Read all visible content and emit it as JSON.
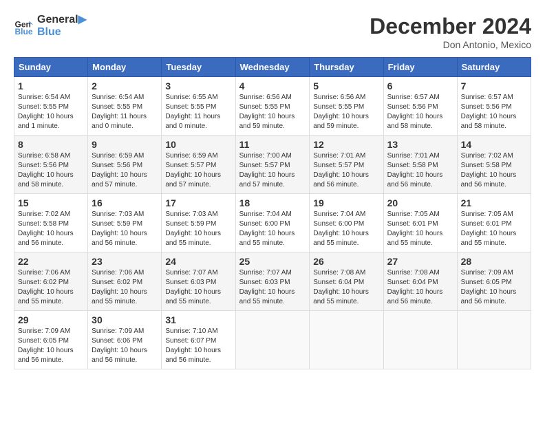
{
  "header": {
    "logo_line1": "General",
    "logo_line2": "Blue",
    "month": "December 2024",
    "location": "Don Antonio, Mexico"
  },
  "weekdays": [
    "Sunday",
    "Monday",
    "Tuesday",
    "Wednesday",
    "Thursday",
    "Friday",
    "Saturday"
  ],
  "weeks": [
    [
      {
        "day": "1",
        "sunrise": "6:54 AM",
        "sunset": "5:55 PM",
        "daylight": "10 hours and 1 minute."
      },
      {
        "day": "2",
        "sunrise": "6:54 AM",
        "sunset": "5:55 PM",
        "daylight": "11 hours and 0 minutes."
      },
      {
        "day": "3",
        "sunrise": "6:55 AM",
        "sunset": "5:55 PM",
        "daylight": "11 hours and 0 minutes."
      },
      {
        "day": "4",
        "sunrise": "6:56 AM",
        "sunset": "5:55 PM",
        "daylight": "10 hours and 59 minutes."
      },
      {
        "day": "5",
        "sunrise": "6:56 AM",
        "sunset": "5:55 PM",
        "daylight": "10 hours and 59 minutes."
      },
      {
        "day": "6",
        "sunrise": "6:57 AM",
        "sunset": "5:56 PM",
        "daylight": "10 hours and 58 minutes."
      },
      {
        "day": "7",
        "sunrise": "6:57 AM",
        "sunset": "5:56 PM",
        "daylight": "10 hours and 58 minutes."
      }
    ],
    [
      {
        "day": "8",
        "sunrise": "6:58 AM",
        "sunset": "5:56 PM",
        "daylight": "10 hours and 58 minutes."
      },
      {
        "day": "9",
        "sunrise": "6:59 AM",
        "sunset": "5:56 PM",
        "daylight": "10 hours and 57 minutes."
      },
      {
        "day": "10",
        "sunrise": "6:59 AM",
        "sunset": "5:57 PM",
        "daylight": "10 hours and 57 minutes."
      },
      {
        "day": "11",
        "sunrise": "7:00 AM",
        "sunset": "5:57 PM",
        "daylight": "10 hours and 57 minutes."
      },
      {
        "day": "12",
        "sunrise": "7:01 AM",
        "sunset": "5:57 PM",
        "daylight": "10 hours and 56 minutes."
      },
      {
        "day": "13",
        "sunrise": "7:01 AM",
        "sunset": "5:58 PM",
        "daylight": "10 hours and 56 minutes."
      },
      {
        "day": "14",
        "sunrise": "7:02 AM",
        "sunset": "5:58 PM",
        "daylight": "10 hours and 56 minutes."
      }
    ],
    [
      {
        "day": "15",
        "sunrise": "7:02 AM",
        "sunset": "5:58 PM",
        "daylight": "10 hours and 56 minutes."
      },
      {
        "day": "16",
        "sunrise": "7:03 AM",
        "sunset": "5:59 PM",
        "daylight": "10 hours and 56 minutes."
      },
      {
        "day": "17",
        "sunrise": "7:03 AM",
        "sunset": "5:59 PM",
        "daylight": "10 hours and 55 minutes."
      },
      {
        "day": "18",
        "sunrise": "7:04 AM",
        "sunset": "6:00 PM",
        "daylight": "10 hours and 55 minutes."
      },
      {
        "day": "19",
        "sunrise": "7:04 AM",
        "sunset": "6:00 PM",
        "daylight": "10 hours and 55 minutes."
      },
      {
        "day": "20",
        "sunrise": "7:05 AM",
        "sunset": "6:01 PM",
        "daylight": "10 hours and 55 minutes."
      },
      {
        "day": "21",
        "sunrise": "7:05 AM",
        "sunset": "6:01 PM",
        "daylight": "10 hours and 55 minutes."
      }
    ],
    [
      {
        "day": "22",
        "sunrise": "7:06 AM",
        "sunset": "6:02 PM",
        "daylight": "10 hours and 55 minutes."
      },
      {
        "day": "23",
        "sunrise": "7:06 AM",
        "sunset": "6:02 PM",
        "daylight": "10 hours and 55 minutes."
      },
      {
        "day": "24",
        "sunrise": "7:07 AM",
        "sunset": "6:03 PM",
        "daylight": "10 hours and 55 minutes."
      },
      {
        "day": "25",
        "sunrise": "7:07 AM",
        "sunset": "6:03 PM",
        "daylight": "10 hours and 55 minutes."
      },
      {
        "day": "26",
        "sunrise": "7:08 AM",
        "sunset": "6:04 PM",
        "daylight": "10 hours and 55 minutes."
      },
      {
        "day": "27",
        "sunrise": "7:08 AM",
        "sunset": "6:04 PM",
        "daylight": "10 hours and 56 minutes."
      },
      {
        "day": "28",
        "sunrise": "7:09 AM",
        "sunset": "6:05 PM",
        "daylight": "10 hours and 56 minutes."
      }
    ],
    [
      {
        "day": "29",
        "sunrise": "7:09 AM",
        "sunset": "6:05 PM",
        "daylight": "10 hours and 56 minutes."
      },
      {
        "day": "30",
        "sunrise": "7:09 AM",
        "sunset": "6:06 PM",
        "daylight": "10 hours and 56 minutes."
      },
      {
        "day": "31",
        "sunrise": "7:10 AM",
        "sunset": "6:07 PM",
        "daylight": "10 hours and 56 minutes."
      },
      null,
      null,
      null,
      null
    ]
  ]
}
